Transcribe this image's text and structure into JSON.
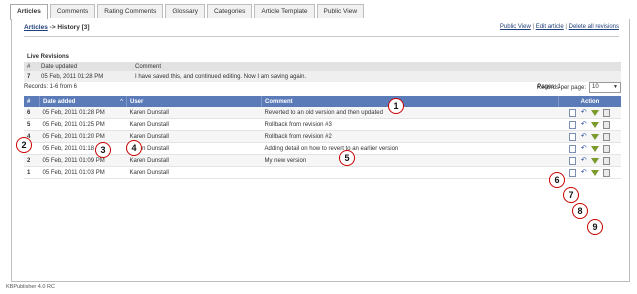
{
  "tabs": [
    "Articles",
    "Comments",
    "Rating Comments",
    "Glossary",
    "Categories",
    "Article Template",
    "Public View"
  ],
  "history": {
    "breadcrumb_link": "Articles",
    "breadcrumb_rest": " -> History [3]",
    "actions": [
      "Public View",
      "Edit article",
      "Delete all revisions"
    ],
    "separator": " | "
  },
  "live": {
    "title": "Live Revisions",
    "headers": [
      "#",
      "Date updated",
      "Comment"
    ],
    "row": {
      "num": "7",
      "date": "05 Feb, 2011 01:28 PM",
      "comment": "I have saved this, and continued editing. Now I am saving again."
    }
  },
  "records": {
    "text": "Records: 1-6 from 6",
    "pages": "Pages: 1",
    "per_page_label": "Records per page:",
    "per_page_value": "10"
  },
  "grid": {
    "headers": [
      "#",
      "Date added",
      "User",
      "Comment",
      "Action"
    ],
    "rows": [
      {
        "num": "6",
        "date": "05 Feb, 2011 01:28 PM",
        "user": "Karen Dunstall",
        "comment": "Reverted to an old version and then updated"
      },
      {
        "num": "5",
        "date": "05 Feb, 2011 01:25 PM",
        "user": "Karen Dunstall",
        "comment": "Rollback from revision #3"
      },
      {
        "num": "4",
        "date": "05 Feb, 2011 01:20 PM",
        "user": "Karen Dunstall",
        "comment": "Rollback from revision #2"
      },
      {
        "num": "3",
        "date": "05 Feb, 2011 01:18 PM",
        "user": "Karen Dunstall",
        "comment": "Adding detail on how to revert to an earlier version"
      },
      {
        "num": "2",
        "date": "05 Feb, 2011 01:09 PM",
        "user": "Karen Dunstall",
        "comment": "My new version"
      },
      {
        "num": "1",
        "date": "05 Feb, 2011 01:03 PM",
        "user": "Karen Dunstall",
        "comment": ""
      }
    ],
    "sort_indicator": "^"
  },
  "callouts": [
    "1",
    "2",
    "3",
    "4",
    "5",
    "6",
    "7",
    "8",
    "9"
  ],
  "footer": "KBPublisher 4.0 RC",
  "colors": {
    "header_blue": "#5a7ab8",
    "callout_red": "#cc0000"
  }
}
